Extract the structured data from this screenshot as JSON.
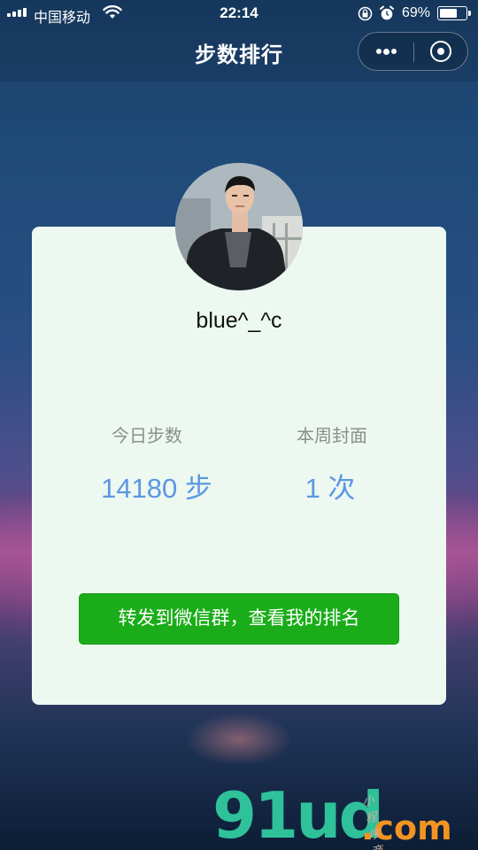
{
  "status_bar": {
    "carrier": "中国移动",
    "time": "22:14",
    "battery_pct": "69%",
    "battery_level": 0.69,
    "icons": [
      "signal-icon",
      "wifi-icon",
      "rotation-lock-icon",
      "alarm-icon",
      "battery-icon"
    ]
  },
  "nav": {
    "title": "步数排行",
    "capsule": {
      "more_icon": "more-dots-icon",
      "close_icon": "target-close-icon"
    }
  },
  "profile": {
    "username": "blue^_^c"
  },
  "stats": {
    "today": {
      "label": "今日步数",
      "value": "14180 步"
    },
    "week": {
      "label": "本周封面",
      "value": "1 次"
    }
  },
  "actions": {
    "share_label": "转发到微信群，查看我的排名"
  },
  "watermark": {
    "main": "91ud",
    "suffix": ".com",
    "tagline": "小程序商店"
  },
  "colors": {
    "accent_green": "#1aad19",
    "stat_blue": "#5b97e2",
    "card_bg": "#edf8f1",
    "nav_bg": "#16375c"
  }
}
